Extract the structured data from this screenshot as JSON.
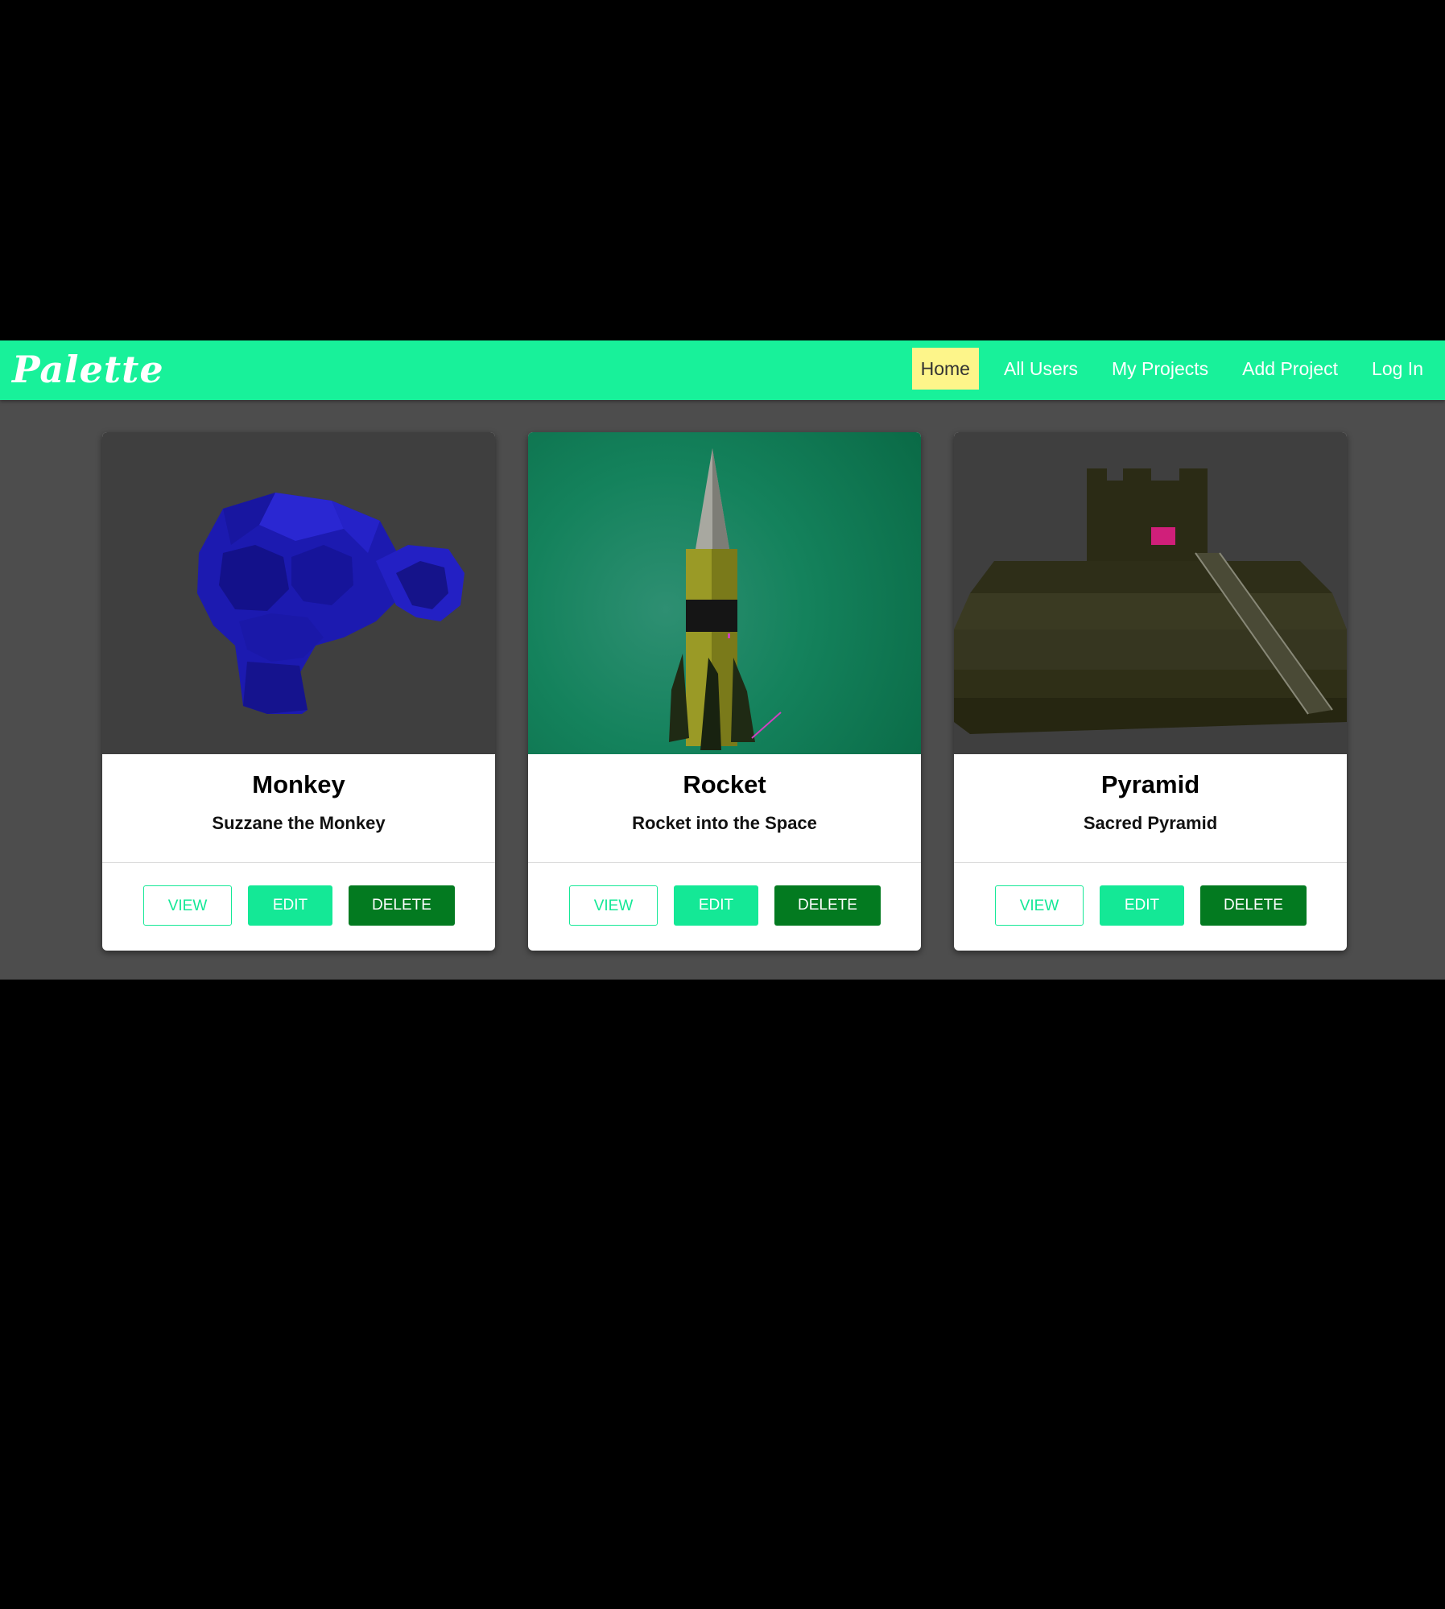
{
  "navbar": {
    "brand": "Palette",
    "links": [
      {
        "label": "Home",
        "active": true
      },
      {
        "label": "All Users",
        "active": false
      },
      {
        "label": "My Projects",
        "active": false
      },
      {
        "label": "Add Project",
        "active": false
      },
      {
        "label": "Log In",
        "active": false
      }
    ]
  },
  "projects": [
    {
      "title": "Monkey",
      "subtitle": "Suzzane the Monkey",
      "image": "blue-monkey-3d-render",
      "view_label": "VIEW",
      "edit_label": "EDIT",
      "delete_label": "DELETE"
    },
    {
      "title": "Rocket",
      "subtitle": "Rocket into the Space",
      "image": "rocket-3d-render",
      "view_label": "VIEW",
      "edit_label": "EDIT",
      "delete_label": "DELETE"
    },
    {
      "title": "Pyramid",
      "subtitle": "Sacred Pyramid",
      "image": "pyramid-3d-render",
      "view_label": "VIEW",
      "edit_label": "EDIT",
      "delete_label": "DELETE"
    }
  ],
  "colors": {
    "navbar": "#18f19a",
    "page_background": "#4d4d4d",
    "outer_background": "#000000",
    "active_link": "#fdf58a",
    "edit_button": "#14e896",
    "delete_button": "#037a20",
    "monkey_blue": "#1c1ab0",
    "rocket_body": "#9a9a26"
  }
}
